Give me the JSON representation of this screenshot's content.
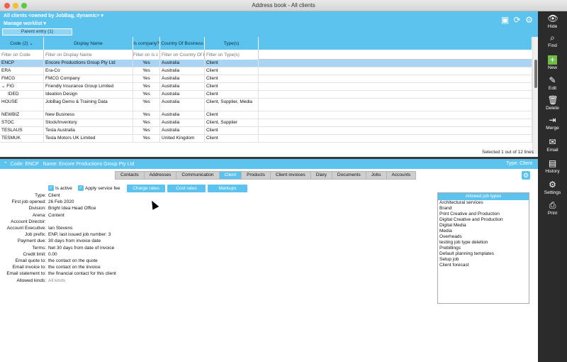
{
  "window": {
    "title": "Address book - All clients"
  },
  "toolbar": {
    "view_title": "All clients <owned by JobBag, dynamic>",
    "manage_worklist": "Manage worklist",
    "parent_entry": "Parent entry (1)"
  },
  "grid": {
    "headers": [
      "Code (2)",
      "Display Name",
      "Is company?",
      "Country Of Business",
      "Type(s)"
    ],
    "filters": [
      "Filter on Code",
      "Filter on Display Name",
      "Filter on Is c",
      "Filter on Country Of B",
      "Filter on Type(s)"
    ],
    "rows": [
      {
        "code": "ENCP",
        "name": "Encore Productions Group Pty Ltd",
        "is_company": "Yes",
        "country": "Australia",
        "types": "Client"
      },
      {
        "code": "ERA",
        "name": "Era-Co",
        "is_company": "Yes",
        "country": "Australia",
        "types": "Client"
      },
      {
        "code": "FMCG",
        "name": "FMCG Company",
        "is_company": "Yes",
        "country": "Australia",
        "types": "Client"
      },
      {
        "code": "FIG",
        "name": "Friendly Insurance Group Limited",
        "is_company": "Yes",
        "country": "Australia",
        "types": "Client"
      },
      {
        "code": "IDED",
        "name": "Ideation Design",
        "is_company": "Yes",
        "country": "Australia",
        "types": "Client"
      },
      {
        "code": "HOUSE",
        "name": "JobBag Demo & Training Data",
        "is_company": "Yes",
        "country": "Australia",
        "types": "Client, Supplier, Media"
      },
      {
        "code": "NEWBIZ",
        "name": "New Business",
        "is_company": "Yes",
        "country": "Australia",
        "types": "Client"
      },
      {
        "code": "STOC",
        "name": "Stock/Inventory",
        "is_company": "Yes",
        "country": "Australia",
        "types": "Client, Supplier"
      },
      {
        "code": "TESLAUS",
        "name": "Tesla Australia",
        "is_company": "Yes",
        "country": "Australia",
        "types": "Client"
      },
      {
        "code": "TESMUK",
        "name": "Tesla Motors UK Limited",
        "is_company": "Yes",
        "country": "United Kingdom",
        "types": "Client"
      }
    ],
    "selection_info": "Selected 1 out of 12 lines"
  },
  "detail": {
    "header_left": "Code: ENCP   Name: Encore Productions Group Pty Ltd",
    "header_right": "Type: Client",
    "tabs": [
      "Contacts",
      "Addresses",
      "Communication",
      "Client",
      "Products",
      "Client invoices",
      "Diary",
      "Documents",
      "Jobs",
      "Accounts"
    ],
    "is_active_label": "Is active",
    "apply_fee_label": "Apply service fee",
    "buttons": {
      "charge_rates": "Charge rates",
      "cost_rates": "Cost rates",
      "markups": "Markups"
    },
    "fields": [
      {
        "label": "Type:",
        "value": "Client"
      },
      {
        "label": "First job opened:",
        "value": "26 Feb 2020"
      },
      {
        "label": "Division:",
        "value": "Bright Idea Head Office"
      },
      {
        "label": "Arena:",
        "value": "Content"
      },
      {
        "label": "Account Director:",
        "value": ""
      },
      {
        "label": "Account Executive:",
        "value": "Ian Stevens"
      },
      {
        "label": "Job prefix:",
        "value": "ENP, last issued job number: 3"
      },
      {
        "label": "Payment due:",
        "value": "30 days from invoice date"
      },
      {
        "label": "Terms:",
        "value": "Net 30 days from date of invoice"
      },
      {
        "label": "Credit limit:",
        "value": "0.00"
      },
      {
        "label": "Email quote to:",
        "value": "the contact on the quote"
      },
      {
        "label": "Email invoice to:",
        "value": "the contact on the invoice"
      },
      {
        "label": "Email statement to:",
        "value": "the financial contact for this client"
      },
      {
        "label": "Allowed kinds:",
        "value": "All kinds"
      }
    ],
    "allowed_job_types_title": "Allowed job types",
    "allowed_job_types": [
      "Architectural services",
      "Brand",
      "Print Creative and Production",
      "Digital Creative and Production",
      "Digital Media",
      "Media",
      "Overheads",
      "testing job type deletion",
      "Prebillings",
      "Default planning templates",
      "Setup job",
      "Client forecast"
    ]
  },
  "sidebar": {
    "hide": "Hide",
    "find": "Find",
    "new": "New",
    "edit": "Edit",
    "delete": "Delete",
    "merge": "Merge",
    "email": "Email",
    "history": "History",
    "settings": "Settings",
    "print": "Print"
  },
  "colors": {
    "accent": "#5bc3ee",
    "sidebar": "#2b2b2b",
    "new_green": "#6fbe45",
    "selected_row": "#a9d4f3"
  }
}
